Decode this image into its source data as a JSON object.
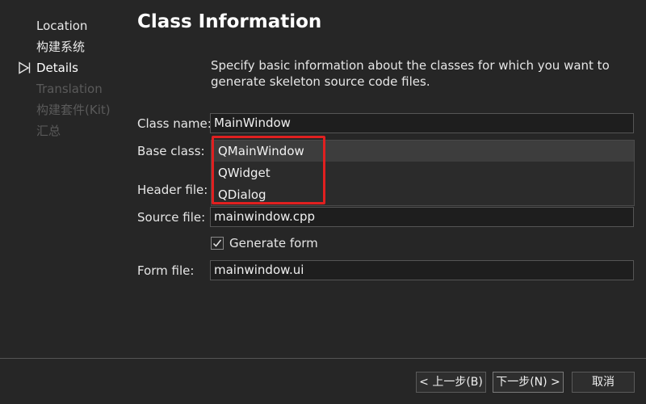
{
  "wizard": {
    "steps": [
      {
        "label": "Location",
        "state": "done"
      },
      {
        "label": "构建系统",
        "state": "done"
      },
      {
        "label": "Details",
        "state": "current"
      },
      {
        "label": "Translation",
        "state": "pending"
      },
      {
        "label": "构建套件(Kit)",
        "state": "pending"
      },
      {
        "label": "汇总",
        "state": "pending"
      }
    ],
    "current_step_icon": "triangle-right-icon"
  },
  "page": {
    "title": "Class Information",
    "description": "Specify basic information about the classes for which you want to generate skeleton source code files."
  },
  "form": {
    "class_name": {
      "label": "Class name:",
      "value": "MainWindow"
    },
    "base_class": {
      "label": "Base class:",
      "options": [
        "QMainWindow",
        "QWidget",
        "QDialog"
      ],
      "selected": "QMainWindow"
    },
    "header_file": {
      "label": "Header file:"
    },
    "source_file": {
      "label": "Source file:",
      "value": "mainwindow.cpp"
    },
    "generate_form": {
      "label": "Generate form",
      "checked": true
    },
    "form_file": {
      "label": "Form file:",
      "value": "mainwindow.ui"
    }
  },
  "buttons": {
    "back": "< 上一步(B)",
    "next": "下一步(N) >",
    "cancel": "取消"
  },
  "colors": {
    "background": "#262626",
    "highlight_annotation": "#e02020"
  }
}
